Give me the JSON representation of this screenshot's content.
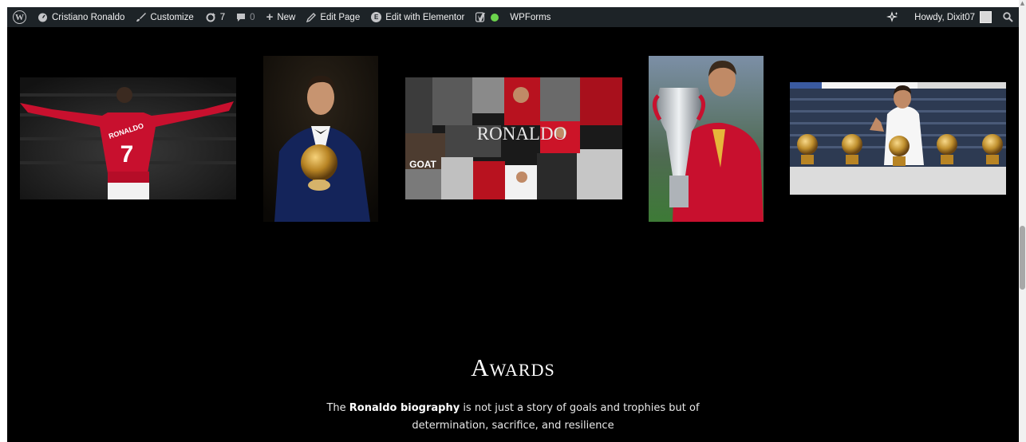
{
  "admin_bar": {
    "site_name": "Cristiano Ronaldo",
    "customize": "Customize",
    "updates_count": "7",
    "comments_count": "0",
    "new": "New",
    "edit_page": "Edit Page",
    "edit_elementor": "Edit with Elementor",
    "wpforms": "WPForms",
    "howdy": "Howdy, Dixit07"
  },
  "gallery": {
    "collage_title": "RONALDO",
    "collage_badge": "GOAT",
    "jersey_name": "RONALDO",
    "jersey_number": "7"
  },
  "awards": {
    "title": "Awards",
    "text_lead": "The ",
    "text_bold": "Ronaldo biography",
    "text_rest": " is not just a story of goals and trophies but of determination, sacrifice, and resilience"
  },
  "colors": {
    "admin_bar_bg": "#1d2327",
    "page_bg": "#000000",
    "jersey_red": "#c8102e"
  }
}
